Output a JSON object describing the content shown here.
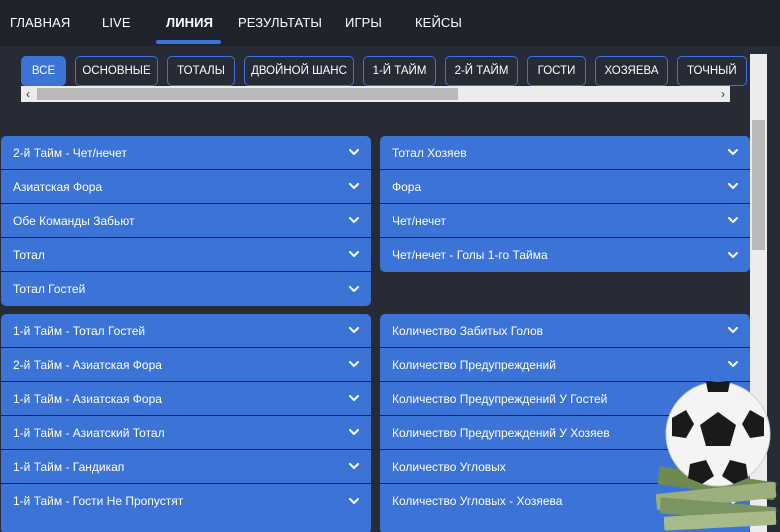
{
  "nav": {
    "items": [
      "ГЛАВНАЯ",
      "LIVE",
      "ЛИНИЯ",
      "РЕЗУЛЬТАТЫ",
      "ИГРЫ",
      "КЕЙСЫ"
    ],
    "active": "ЛИНИЯ"
  },
  "filters": {
    "items": [
      "ВСЕ",
      "ОСНОВНЫЕ",
      "ТОТАЛЫ",
      "ДВОЙНОЙ ШАНС",
      "1-Й ТАЙМ",
      "2-Й ТАЙМ",
      "ГОСТИ",
      "ХОЗЯЕВА",
      "ТОЧНЫЙ"
    ],
    "active": "ВСЕ"
  },
  "left_group_1": [
    "2-й Тайм - Чет/нечет",
    "Азиатская Фора",
    "Обе Команды Забьют",
    "Тотал",
    "Тотал Гостей"
  ],
  "right_group_1": [
    "Тотал Хозяев",
    "Фора",
    "Чет/нечет",
    "Чет/нечет - Голы 1-го Тайма"
  ],
  "left_group_2": [
    "1-й Тайм - Тотал Гостей",
    "2-й Тайм - Азиатская Фора",
    "1-й Тайм - Азиатская Фора",
    "1-й Тайм - Азиатский Тотал",
    "1-й Тайм - Гандикап",
    "1-й Тайм - Гости Не Пропустят"
  ],
  "right_group_2": [
    "Количество Забитых Голов",
    "Количество Предупреждений",
    "Количество Предупреждений У Гостей",
    "Количество Предупреждений У Хозяев",
    "Количество Угловых",
    "Количество Угловых - Хозяева"
  ],
  "colors": {
    "accent": "#3b73d6",
    "background": "#262b35",
    "nav": "#1f232b"
  },
  "icons": {
    "chevron": "chevron-down-icon",
    "ball": "soccer-ball-money-icon"
  }
}
